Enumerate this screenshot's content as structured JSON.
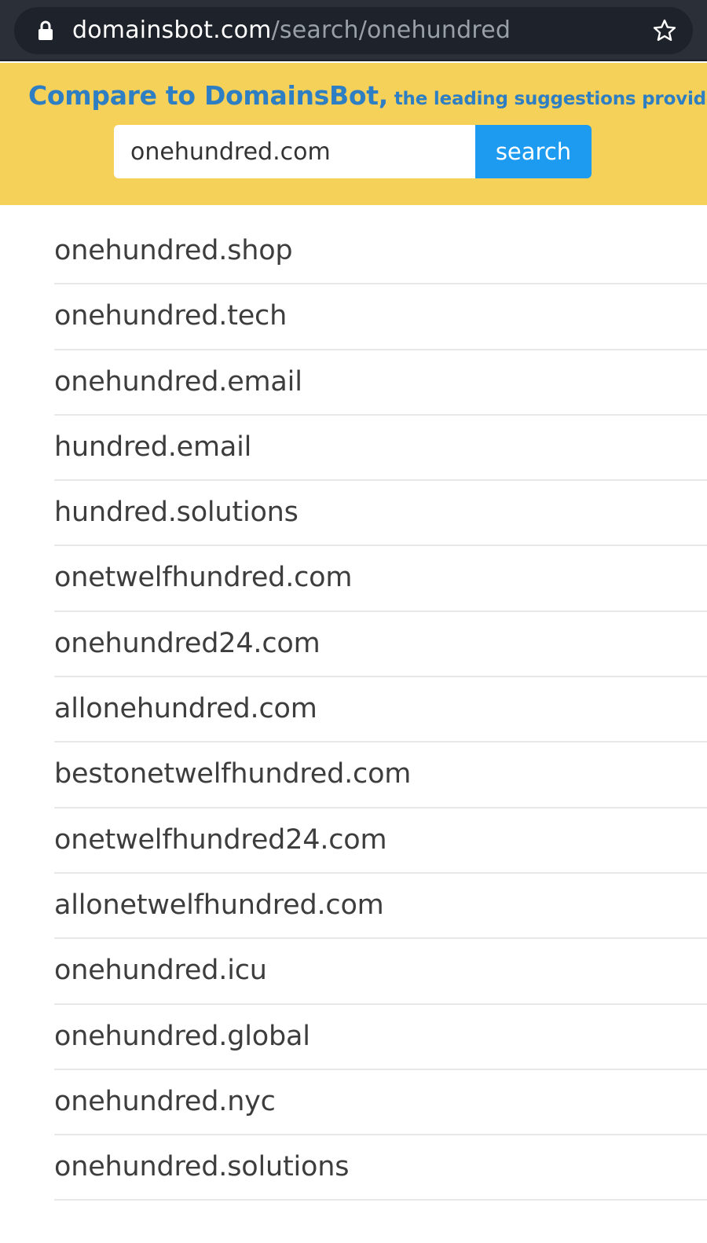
{
  "browser": {
    "url_host": "domainsbot.com",
    "url_path": "/search/onehundred",
    "icons": [
      "lock-icon",
      "star-icon"
    ]
  },
  "banner": {
    "heading_main": "Compare to DomainsBot,",
    "heading_sub": " the leading suggestions provider:",
    "search_value": "onehundred.com",
    "search_button_label": "search",
    "colors": {
      "background": "#f6d15a",
      "heading": "#2e7ec4",
      "button": "#1d9bf0"
    }
  },
  "results": [
    "onehundred.shop",
    "onehundred.tech",
    "onehundred.email",
    "hundred.email",
    "hundred.solutions",
    "onetwelfhundred.com",
    "onehundred24.com",
    "allonehundred.com",
    "bestonetwelfhundred.com",
    "onetwelfhundred24.com",
    "allonetwelfhundred.com",
    "onehundred.icu",
    "onehundred.global",
    "onehundred.nyc",
    "onehundred.solutions"
  ]
}
